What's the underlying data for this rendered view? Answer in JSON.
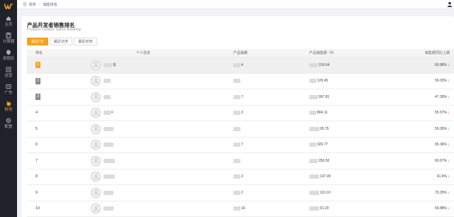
{
  "sidebar": {
    "items": [
      {
        "label": "主页",
        "icon": "home-icon",
        "active": false
      },
      {
        "label": "计算器",
        "icon": "calculator-icon",
        "active": false
      },
      {
        "label": "进销存",
        "icon": "inventory-icon",
        "active": false
      },
      {
        "label": "运营",
        "icon": "operations-icon",
        "active": false
      },
      {
        "label": "广告",
        "icon": "ads-icon",
        "active": false
      },
      {
        "label": "财务",
        "icon": "finance-icon",
        "active": true
      },
      {
        "label": "配置",
        "icon": "settings-icon",
        "active": false
      }
    ]
  },
  "topbar": {
    "breadcrumb": [
      "财务",
      "销售排名"
    ]
  },
  "card": {
    "title": "产品开发者销售排名",
    "subtitle": "Product Creator Sales Ranking",
    "tabs": [
      {
        "label": "最近7天",
        "active": true
      },
      {
        "label": "最近15天",
        "active": false
      },
      {
        "label": "最近30天",
        "active": false
      }
    ]
  },
  "table": {
    "headers": [
      "排名",
      "个人信息",
      "产品销量",
      "产品销售额（¥）",
      "销售额同比上期"
    ],
    "rows": [
      {
        "rank": "1",
        "medal": "gold",
        "name": "东",
        "count": "4",
        "sales": "319.64",
        "ratio": "60.88%"
      },
      {
        "rank": "2",
        "medal": "silver",
        "name": "",
        "count": "",
        "sales": "129.45",
        "ratio": "59.03%"
      },
      {
        "rank": "3",
        "medal": "bronze",
        "name": "",
        "count": "7",
        "sales": "997.81",
        "ratio": "47.28%"
      },
      {
        "rank": "4",
        "medal": "",
        "name": "F",
        "count": "3",
        "sales": "804.11",
        "ratio": "55.57%"
      },
      {
        "rank": "5",
        "medal": "",
        "name": "",
        "count": "",
        "sales": "05.75",
        "ratio": "50.05%"
      },
      {
        "rank": "6",
        "medal": "",
        "name": "",
        "count": "7",
        "sales": "326.77",
        "ratio": "65.36%"
      },
      {
        "rank": "7",
        "medal": "",
        "name": "",
        "count": "",
        "sales": "256.50",
        "ratio": "60.67%"
      },
      {
        "rank": "8",
        "medal": "",
        "name": "",
        "count": "3",
        "sales": "137.49",
        "ratio": "41.6%"
      },
      {
        "rank": "9",
        "medal": "",
        "name": "",
        "count": "2",
        "sales": "110.10",
        "ratio": "79.25%"
      },
      {
        "rank": "10",
        "medal": "",
        "name": "",
        "count": "16",
        "sales": "91.20",
        "ratio": "59.88%"
      }
    ]
  },
  "colors": {
    "accent": "#f7a21b",
    "sidebar_bg": "#1f2329",
    "down_arrow": "#e84a2f"
  }
}
